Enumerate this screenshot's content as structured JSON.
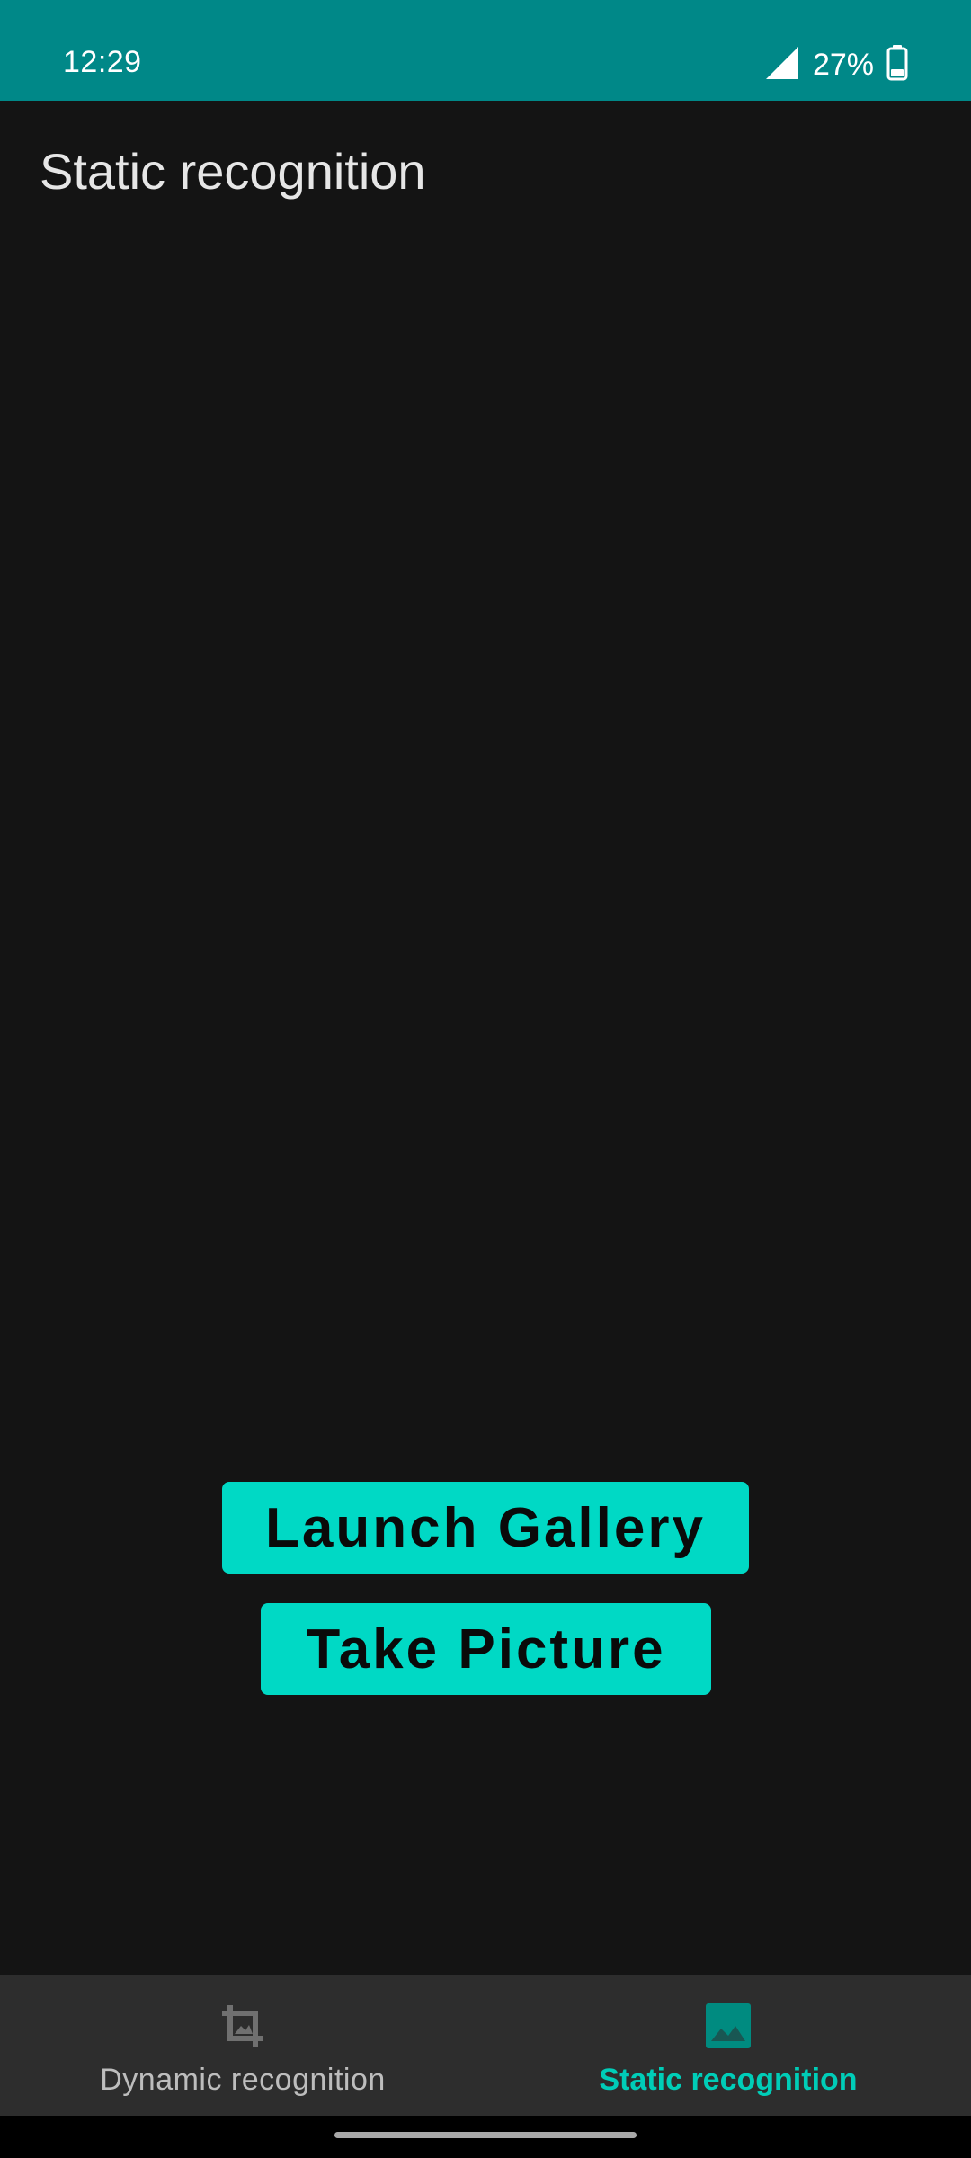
{
  "status_bar": {
    "time": "12:29",
    "battery_percent": "27%",
    "signal_icon": "cellular-signal-icon",
    "battery_icon": "battery-icon",
    "background_color": "#008888"
  },
  "page": {
    "title": "Static recognition"
  },
  "buttons": {
    "launch_gallery": "Launch Gallery",
    "take_picture": "Take Picture",
    "accent_color": "#00d9c5"
  },
  "bottom_nav": {
    "items": [
      {
        "label": "Dynamic recognition",
        "icon": "crop-image-icon",
        "active": false
      },
      {
        "label": "Static recognition",
        "icon": "image-icon",
        "active": true
      }
    ],
    "active_color": "#00cdb8"
  }
}
